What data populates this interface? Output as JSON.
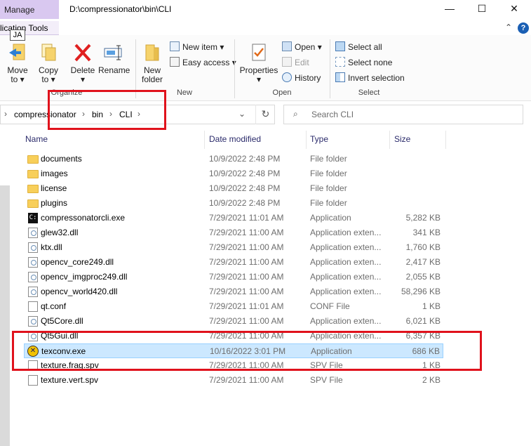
{
  "window": {
    "title_path": "D:\\compressionator\\bin\\CLI",
    "manage_tab": "Manage",
    "app_tools_tab": "lication Tools",
    "ja_badge": "JA",
    "minimize": "—",
    "maximize": "☐",
    "close": "✕"
  },
  "ribbon": {
    "organize": {
      "label": "Organize",
      "move_to": "Move\nto ▾",
      "copy_to": "Copy\nto ▾",
      "delete": "Delete\n▾",
      "rename": "Rename"
    },
    "new": {
      "label": "New",
      "new_folder": "New\nfolder",
      "new_item": "New item ▾",
      "easy_access": "Easy access ▾"
    },
    "open": {
      "label": "Open",
      "properties": "Properties\n▾",
      "open": "Open ▾",
      "edit": "Edit",
      "history": "History"
    },
    "select": {
      "label": "Select",
      "select_all": "Select all",
      "select_none": "Select none",
      "invert_selection": "Invert selection"
    }
  },
  "address": {
    "crumbs": [
      "compressionator",
      "bin",
      "CLI"
    ],
    "search_placeholder": "Search CLI"
  },
  "columns": {
    "name": "Name",
    "date": "Date modified",
    "type": "Type",
    "size": "Size"
  },
  "files": [
    {
      "name": "documents",
      "date": "10/9/2022 2:48 PM",
      "type": "File folder",
      "size": "",
      "icon": "folder-icon"
    },
    {
      "name": "images",
      "date": "10/9/2022 2:48 PM",
      "type": "File folder",
      "size": "",
      "icon": "folder-icon"
    },
    {
      "name": "license",
      "date": "10/9/2022 2:48 PM",
      "type": "File folder",
      "size": "",
      "icon": "folder-icon"
    },
    {
      "name": "plugins",
      "date": "10/9/2022 2:48 PM",
      "type": "File folder",
      "size": "",
      "icon": "folder-icon"
    },
    {
      "name": "compressonatorcli.exe",
      "date": "7/29/2021 11:01 AM",
      "type": "Application",
      "size": "5,282 KB",
      "icon": "console-exe-icon"
    },
    {
      "name": "glew32.dll",
      "date": "7/29/2021 11:00 AM",
      "type": "Application exten...",
      "size": "341 KB",
      "icon": "dll-icon"
    },
    {
      "name": "ktx.dll",
      "date": "7/29/2021 11:00 AM",
      "type": "Application exten...",
      "size": "1,760 KB",
      "icon": "dll-icon"
    },
    {
      "name": "opencv_core249.dll",
      "date": "7/29/2021 11:00 AM",
      "type": "Application exten...",
      "size": "2,417 KB",
      "icon": "dll-icon"
    },
    {
      "name": "opencv_imgproc249.dll",
      "date": "7/29/2021 11:00 AM",
      "type": "Application exten...",
      "size": "2,055 KB",
      "icon": "dll-icon"
    },
    {
      "name": "opencv_world420.dll",
      "date": "7/29/2021 11:00 AM",
      "type": "Application exten...",
      "size": "58,296 KB",
      "icon": "dll-icon"
    },
    {
      "name": "qt.conf",
      "date": "7/29/2021 11:01 AM",
      "type": "CONF File",
      "size": "1 KB",
      "icon": "file-icon"
    },
    {
      "name": "Qt5Core.dll",
      "date": "7/29/2021 11:00 AM",
      "type": "Application exten...",
      "size": "6,021 KB",
      "icon": "dll-icon"
    },
    {
      "name": "Qt5Gui.dll",
      "date": "7/29/2021 11:00 AM",
      "type": "Application exten...",
      "size": "6,357 KB",
      "icon": "dll-icon"
    },
    {
      "name": "texconv.exe",
      "date": "10/16/2022 3:01 PM",
      "type": "Application",
      "size": "686 KB",
      "icon": "texconv-icon",
      "selected": true
    },
    {
      "name": "texture.frag.spv",
      "date": "7/29/2021 11:00 AM",
      "type": "SPV File",
      "size": "1 KB",
      "icon": "file-icon"
    },
    {
      "name": "texture.vert.spv",
      "date": "7/29/2021 11:00 AM",
      "type": "SPV File",
      "size": "2 KB",
      "icon": "file-icon"
    }
  ],
  "colors": {
    "selection": "#cce8ff",
    "annotation_red": "#e0121c",
    "manage_tab": "#d9c8f0"
  }
}
